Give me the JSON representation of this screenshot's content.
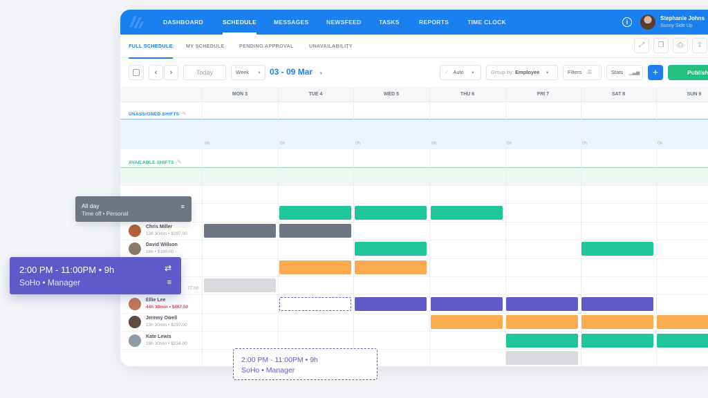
{
  "nav": {
    "items": [
      {
        "label": "DASHBOARD",
        "active": false
      },
      {
        "label": "SCHEDULE",
        "active": true
      },
      {
        "label": "MESSAGES",
        "active": false
      },
      {
        "label": "NEWSFEED",
        "active": false
      },
      {
        "label": "TASKS",
        "active": false
      },
      {
        "label": "REPORTS",
        "active": false
      },
      {
        "label": "TIME CLOCK",
        "active": false
      }
    ],
    "user_name": "Stephanie Johns",
    "user_org": "Sunny Side Up",
    "info_glyph": "i",
    "brand_color": "#1a80f0"
  },
  "subtabs": {
    "items": [
      {
        "label": "FULL SCHEDULE",
        "active": true
      },
      {
        "label": "MY SCHEDULE",
        "active": false
      },
      {
        "label": "PENDING APPROVAL",
        "active": false
      },
      {
        "label": "UNAVAILABILITY",
        "active": false
      }
    ],
    "icons": [
      "expand-icon",
      "copy-icon",
      "print-icon",
      "export-icon"
    ],
    "icon_glyphs": [
      "⤢",
      "❐",
      "⎙",
      "⇪"
    ]
  },
  "toolbar": {
    "prev_glyph": "‹",
    "next_glyph": "›",
    "today_label": "Today",
    "view_label": "Week",
    "date_range": "03 - 09 Mar",
    "auto_label": "Auto",
    "group_by_prefix": "Group by:",
    "group_by_value": "Employee",
    "filters_label": "Filters",
    "stats_label": "Stats",
    "add_glyph": "+",
    "publish_label": "Publish"
  },
  "days": [
    "MON 3",
    "TUE 4",
    "WED 5",
    "THU 6",
    "FRI 7",
    "SAT 8",
    "SUN 9"
  ],
  "bands": {
    "unassigned_label": "UNASSIGNED SHIFTS",
    "available_label": "AVAILABLE SHIFTS",
    "hours": [
      "0h",
      "0h",
      "0h",
      "0h",
      "0h",
      "0h",
      "0h"
    ]
  },
  "employees": [
    {
      "name": "Chris Miller",
      "meta": "13h 30min • $297.00",
      "warn": false,
      "avatar_color": "#b0623f"
    },
    {
      "name": "David Willson",
      "meta": "18h • $180.00",
      "warn": false,
      "avatar_color": "#8a7a6b"
    },
    {
      "name": "",
      "meta": "",
      "warn": false,
      "avatar_color": ""
    },
    {
      "name": "",
      "meta": "77.00",
      "warn": false,
      "avatar_color": ""
    },
    {
      "name": "Ellie Lee",
      "meta": "44h 30min • $467.50",
      "warn": true,
      "avatar_color": "#c0785a"
    },
    {
      "name": "Jeremy Owell",
      "meta": "13h 30min • $297.00",
      "warn": false,
      "avatar_color": "#5e4c42"
    },
    {
      "name": "Kate Lewis",
      "meta": "19h 30min • $234.00",
      "warn": false,
      "avatar_color": "#8e9aa6"
    }
  ],
  "shifts": [
    {
      "row": 0,
      "day": 1,
      "color": "teal"
    },
    {
      "row": 0,
      "day": 2,
      "color": "teal"
    },
    {
      "row": 0,
      "day": 3,
      "color": "teal"
    },
    {
      "row": 1,
      "day": 0,
      "color": "slate"
    },
    {
      "row": 1,
      "day": 1,
      "color": "slate"
    },
    {
      "row": 2,
      "day": 2,
      "color": "teal"
    },
    {
      "row": 2,
      "day": 5,
      "color": "teal"
    },
    {
      "row": 3,
      "day": 1,
      "color": "orange"
    },
    {
      "row": 3,
      "day": 2,
      "color": "orange"
    },
    {
      "row": 4,
      "day": 0,
      "color": "grey"
    },
    {
      "row": 5,
      "day": 1,
      "color": "dashed"
    },
    {
      "row": 5,
      "day": 2,
      "color": "purple"
    },
    {
      "row": 5,
      "day": 3,
      "color": "purple"
    },
    {
      "row": 5,
      "day": 4,
      "color": "purple"
    },
    {
      "row": 5,
      "day": 5,
      "color": "purple"
    },
    {
      "row": 6,
      "day": 3,
      "color": "orange"
    },
    {
      "row": 6,
      "day": 4,
      "color": "orange"
    },
    {
      "row": 6,
      "day": 5,
      "color": "orange"
    },
    {
      "row": 6,
      "day": 6,
      "color": "orange"
    },
    {
      "row": 7,
      "day": 4,
      "color": "teal"
    },
    {
      "row": 7,
      "day": 5,
      "color": "teal"
    },
    {
      "row": 7,
      "day": 6,
      "color": "teal"
    },
    {
      "row": 8,
      "day": 4,
      "color": "grey"
    }
  ],
  "cards": {
    "allday_title": "All day",
    "allday_sub": "Time off • Personal",
    "purple_time": "2:00 PM - 11:00PM • 9h",
    "purple_place": "SoHo • Manager",
    "dashed_time": "2:00 PM - 11:00PM • 9h",
    "dashed_place": "SoHo • Manager",
    "note_glyph": "≡",
    "swap_glyph": "⇄"
  },
  "colors": {
    "teal": "#1fc69a",
    "orange": "#fbab4f",
    "purple": "#6059c9",
    "slate": "#6e7683",
    "grey": "#d9dbde",
    "publish": "#22c081"
  }
}
